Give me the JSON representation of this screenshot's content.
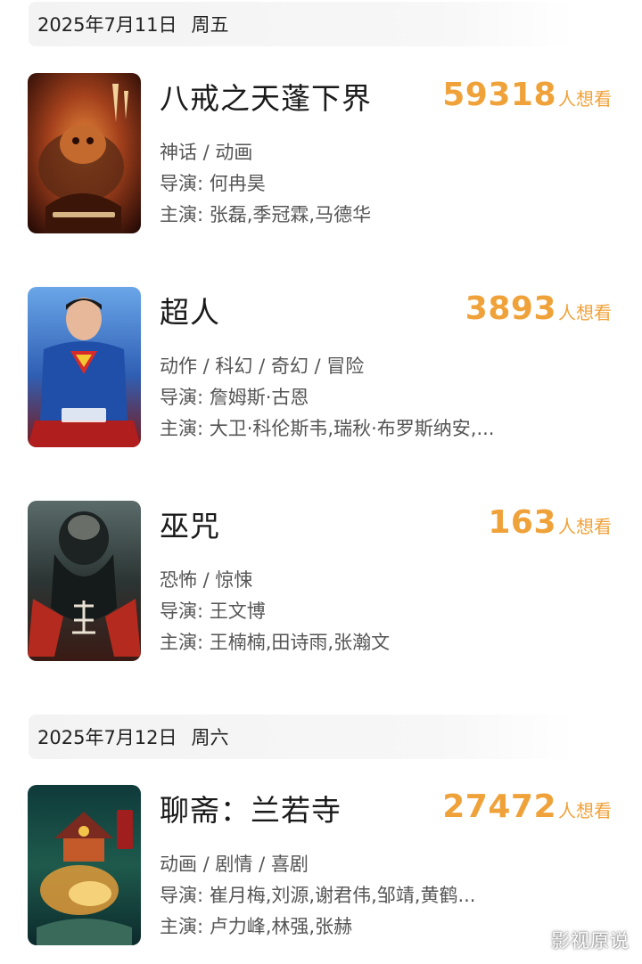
{
  "days": [
    {
      "date": "2025年7月11日",
      "weekday": "周五",
      "movies": [
        {
          "title": "八戒之天蓬下界",
          "want_count": "59318",
          "want_unit": "人想看",
          "genre": "神话 / 动画",
          "director": "导演: 何冉昊",
          "cast": "主演: 张磊,季冠霖,马德华",
          "poster_icon": "bajie-poster"
        },
        {
          "title": "超人",
          "want_count": "3893",
          "want_unit": "人想看",
          "genre": "动作 / 科幻 / 奇幻 / 冒险",
          "director": "导演: 詹姆斯·古恩",
          "cast": "主演: 大卫·科伦斯韦,瑞秋·布罗斯纳安,...",
          "poster_icon": "superman-poster"
        },
        {
          "title": "巫咒",
          "want_count": "163",
          "want_unit": "人想看",
          "genre": "恐怖 / 惊悚",
          "director": "导演: 王文博",
          "cast": "主演: 王楠楠,田诗雨,张瀚文",
          "poster_icon": "wuzhou-poster"
        }
      ]
    },
    {
      "date": "2025年7月12日",
      "weekday": "周六",
      "movies": [
        {
          "title": "聊斋：兰若寺",
          "want_count": "27472",
          "want_unit": "人想看",
          "genre": "动画 / 剧情 / 喜剧",
          "director": "导演: 崔月梅,刘源,谢君伟,邹靖,黄鹤...",
          "cast": "主演: 卢力峰,林强,张赫",
          "poster_icon": "liaozhai-poster"
        }
      ]
    }
  ],
  "watermark": "影视原说",
  "colors": {
    "accent": "#f0a23a",
    "header_bg": "#f3f3f3",
    "title_text": "#1a1a1a",
    "info_text": "#555555"
  }
}
